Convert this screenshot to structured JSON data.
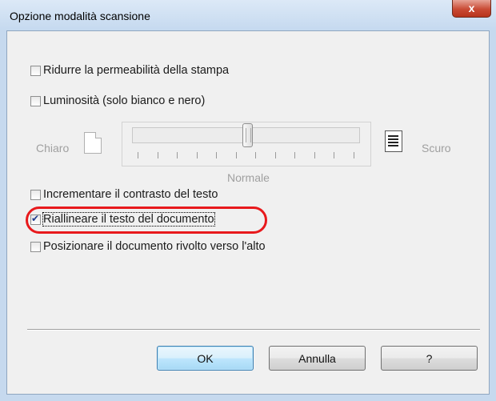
{
  "window": {
    "title": "Opzione modalità scansione",
    "close_symbol": "x"
  },
  "options": [
    {
      "label": "Ridurre la permeabilità della stampa",
      "checked": false
    },
    {
      "label": "Luminosità (solo bianco e nero)",
      "checked": false
    },
    {
      "label": "Incrementare il contrasto del testo",
      "checked": false
    },
    {
      "label": "Riallineare il testo del documento",
      "checked": true
    },
    {
      "label": "Posizionare il documento rivolto verso l'alto",
      "checked": false
    }
  ],
  "brightness": {
    "left_label": "Chiaro",
    "right_label": "Scuro",
    "center_label": "Normale",
    "tick_count": 12
  },
  "buttons": {
    "ok": "OK",
    "cancel": "Annulla",
    "help": "?"
  },
  "colors": {
    "highlight": "#e8191c",
    "check": "#1e3a8c"
  },
  "icons": {
    "light_doc": "document-light-icon",
    "dark_doc": "document-dark-icon"
  }
}
